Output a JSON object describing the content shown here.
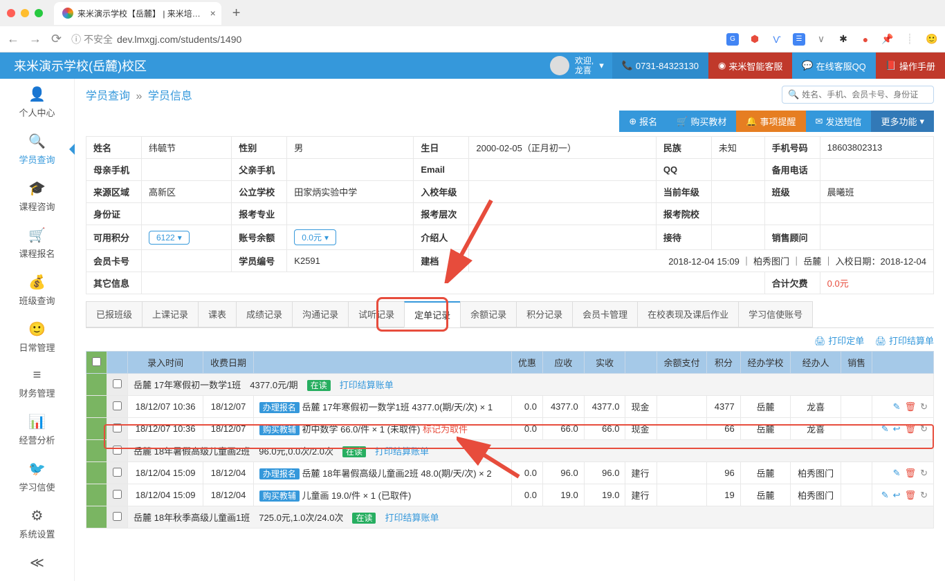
{
  "browser": {
    "tab_title": "来米演示学校【岳麓】 | 来米培…",
    "url": "dev.lmxgj.com/students/1490",
    "insecure_label": "不安全"
  },
  "header": {
    "school": "来米演示学校(岳麓)校区",
    "welcome": "欢迎,",
    "user": "龙喜",
    "phone": "0731-84323130",
    "kf": "来米智能客服",
    "qq": "在线客服QQ",
    "manual": "操作手册"
  },
  "sidebar": [
    {
      "icon": "👤",
      "label": "个人中心"
    },
    {
      "icon": "🔍",
      "label": "学员查询"
    },
    {
      "icon": "🎓",
      "label": "课程咨询"
    },
    {
      "icon": "🛒",
      "label": "课程报名"
    },
    {
      "icon": "💰",
      "label": "班级查询"
    },
    {
      "icon": "🙂",
      "label": "日常管理"
    },
    {
      "icon": "≡",
      "label": "财务管理"
    },
    {
      "icon": "📊",
      "label": "经营分析"
    },
    {
      "icon": "🐦",
      "label": "学习信使"
    },
    {
      "icon": "⚙",
      "label": "系统设置"
    },
    {
      "icon": "≪",
      "label": ""
    }
  ],
  "crumb": {
    "a": "学员查询",
    "b": "学员信息"
  },
  "search": {
    "placeholder": "姓名、手机、会员卡号、身份证"
  },
  "actions": {
    "enroll": "报名",
    "buy": "购买教材",
    "todo": "事项提醒",
    "sms": "发送短信",
    "more": "更多功能"
  },
  "info": {
    "name_l": "姓名",
    "name_v": "纬毓节",
    "sex_l": "性别",
    "sex_v": "男",
    "birth_l": "生日",
    "birth_v": "2000-02-05（正月初一）",
    "nation_l": "民族",
    "nation_v": "未知",
    "phone_l": "手机号码",
    "phone_v": "18603802313",
    "mphone_l": "母亲手机",
    "fphone_l": "父亲手机",
    "email_l": "Email",
    "qq_l": "QQ",
    "bphone_l": "备用电话",
    "area_l": "来源区域",
    "area_v": "高新区",
    "school_l": "公立学校",
    "school_v": "田家炳实验中学",
    "grade_in_l": "入校年级",
    "grade_cur_l": "当前年级",
    "class_l": "班级",
    "class_v": "晨曦班",
    "id_l": "身份证",
    "prof_l": "报考专业",
    "level_l": "报考层次",
    "college_l": "报考院校",
    "score_l": "可用积分",
    "score_v": "6122",
    "balance_l": "账号余额",
    "balance_v": "0.0元",
    "intro_l": "介绍人",
    "rec_l": "接待",
    "sales_l": "销售顾问",
    "card_l": "会员卡号",
    "sid_l": "学员编号",
    "sid_v": "K2591",
    "create_l": "建档",
    "create_v": "2018-12-04 15:09 ｜ 柏秀图门 ｜ 岳麓 ｜ 入校日期：2018-12-04",
    "other_l": "其它信息",
    "debt_l": "合计欠费",
    "debt_v": "0.0元"
  },
  "tabs": [
    "已报班级",
    "上课记录",
    "课表",
    "成绩记录",
    "沟通记录",
    "试听记录",
    "定单记录",
    "余额记录",
    "积分记录",
    "会员卡管理",
    "在校表现及课后作业",
    "学习信使账号"
  ],
  "print": {
    "order": "打印定单",
    "settle": "打印结算单"
  },
  "cols": [
    "录入时间",
    "收费日期",
    "",
    "优惠",
    "应收",
    "实收",
    "",
    "余额支付",
    "积分",
    "经办学校",
    "经办人",
    "销售",
    ""
  ],
  "rows": [
    {
      "type": "head",
      "campus": "岳麓",
      "class": "17年寒假初一数学1班",
      "price": "4377.0元/期",
      "status": "在读",
      "link": "打印结算账单"
    },
    {
      "type": "order",
      "time": "18/12/07 10:36",
      "date": "18/12/07",
      "tag": "办理报名",
      "desc": "岳麓 17年寒假初一数学1班 4377.0(期/天/次) × 1",
      "discount": "0.0",
      "due": "4377.0",
      "paid": "4377.0",
      "method": "现金",
      "score": "4377",
      "school": "岳麓",
      "op": "龙喜"
    },
    {
      "type": "order",
      "time": "18/12/07 10:36",
      "date": "18/12/07",
      "tag": "购买教辅",
      "desc": "初中数学 66.0/件 × 1 (未取件)",
      "mark": "标记为取件",
      "discount": "0.0",
      "due": "66.0",
      "paid": "66.0",
      "method": "现金",
      "score": "66",
      "school": "岳麓",
      "op": "龙喜",
      "hl": true
    },
    {
      "type": "head",
      "campus": "岳麓",
      "class": "18年暑假高级儿童画2班",
      "price": "96.0元,0.0次/2.0次",
      "status": "在读",
      "link": "打印结算账单"
    },
    {
      "type": "order",
      "time": "18/12/04 15:09",
      "date": "18/12/04",
      "tag": "办理报名",
      "desc": "岳麓 18年暑假高级儿童画2班 48.0(期/天/次) × 2",
      "discount": "0.0",
      "due": "96.0",
      "paid": "96.0",
      "method": "建行",
      "score": "96",
      "school": "岳麓",
      "op": "柏秀图门"
    },
    {
      "type": "order",
      "time": "18/12/04 15:09",
      "date": "18/12/04",
      "tag": "购买教辅",
      "desc": "儿童画 19.0/件 × 1 (已取件)",
      "discount": "0.0",
      "due": "19.0",
      "paid": "19.0",
      "method": "建行",
      "score": "19",
      "school": "岳麓",
      "op": "柏秀图门"
    },
    {
      "type": "head",
      "campus": "岳麓",
      "class": "18年秋季高级儿童画1班",
      "price": "725.0元,1.0次/24.0次",
      "status": "在读",
      "link": "打印结算账单"
    }
  ]
}
